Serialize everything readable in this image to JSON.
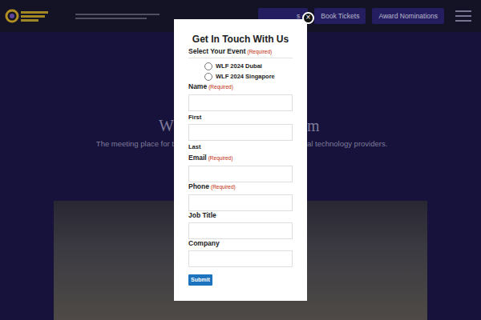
{
  "header": {
    "buttons": [
      {
        "label": "s"
      },
      {
        "label": "Book Tickets"
      },
      {
        "label": "Award Nominations"
      }
    ]
  },
  "hero": {
    "heading": [
      "W",
      "m"
    ],
    "subtitle": [
      "The meeting place for t",
      "al technology providers."
    ]
  },
  "modal": {
    "close": "×",
    "title": "Get In Touch With Us",
    "fields": [
      {
        "kind": "radio",
        "label": "Select Your Event",
        "note": "(Required)",
        "options": [
          {
            "label": "WLF 2024 Dubai",
            "selected": false
          },
          {
            "label": "WLF 2024 Singapore",
            "selected": false
          }
        ]
      },
      {
        "kind": "name",
        "label": "Name",
        "note": "(Required)",
        "sublabels": [
          "First",
          "Last"
        ]
      },
      {
        "kind": "text",
        "label": "Email",
        "note": "(Required)"
      },
      {
        "kind": "text",
        "label": "Phone",
        "note": "(Required)"
      },
      {
        "kind": "text",
        "label": "Job Title"
      },
      {
        "kind": "text",
        "label": "Company"
      }
    ],
    "submit": "Submit"
  }
}
